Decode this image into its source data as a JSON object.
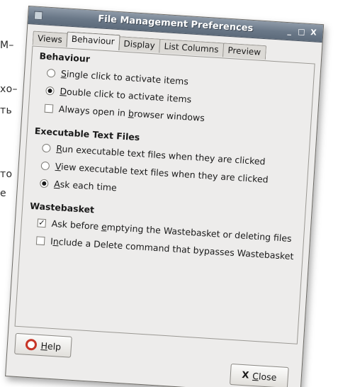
{
  "background": {
    "fragments": [
      "M–",
      "хо–",
      "ть",
      "то",
      "е"
    ]
  },
  "window": {
    "title": "File Management Preferences",
    "controls": {
      "minimize": "_",
      "maximize": "□",
      "close": "X"
    }
  },
  "tabs": [
    {
      "label": "Views",
      "active": false
    },
    {
      "label": "Behaviour",
      "active": true
    },
    {
      "label": "Display",
      "active": false
    },
    {
      "label": "List Columns",
      "active": false
    },
    {
      "label": "Preview",
      "active": false
    }
  ],
  "behaviour": {
    "title": "Behaviour",
    "single_click": {
      "pre": "",
      "u": "S",
      "post": "ingle click to activate items",
      "selected": false
    },
    "double_click": {
      "pre": "",
      "u": "D",
      "post": "ouble click to activate items",
      "selected": true
    },
    "browser_windows": {
      "pre": "Always open in ",
      "u": "b",
      "post": "rowser windows",
      "checked": false
    }
  },
  "executable": {
    "title": "Executable Text Files",
    "run": {
      "pre": "",
      "u": "R",
      "post": "un executable text files when they are clicked",
      "selected": false
    },
    "view": {
      "pre": "",
      "u": "V",
      "post": "iew executable text files when they are clicked",
      "selected": false
    },
    "ask": {
      "pre": "",
      "u": "A",
      "post": "sk each time",
      "selected": true
    }
  },
  "wastebasket": {
    "title": "Wastebasket",
    "ask_before": {
      "pre": "Ask before ",
      "u": "e",
      "post": "mptying the Wastebasket or deleting files",
      "checked": true
    },
    "include_delete": {
      "pre": "I",
      "u": "n",
      "post": "clude a Delete command that bypasses Wastebasket",
      "checked": false
    }
  },
  "buttons": {
    "help": {
      "pre": "",
      "u": "H",
      "post": "elp"
    },
    "close": {
      "pre": "",
      "u": "C",
      "post": "lose",
      "icon": "X"
    }
  },
  "colors": {
    "titlebar": "#6a7888",
    "window_bg": "#edeceb",
    "help_icon": "#c73426"
  }
}
